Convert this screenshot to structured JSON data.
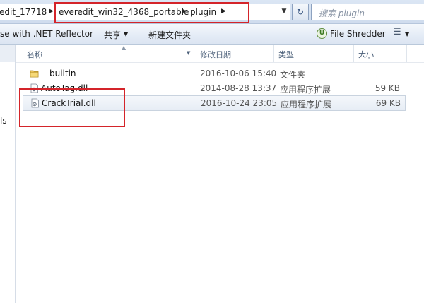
{
  "address_bar": {
    "crumbs": [
      "edit_17718",
      "everedit_win32_4368_portable",
      "plugin"
    ]
  },
  "search": {
    "placeholder": "搜索 plugin"
  },
  "toolbar": {
    "reflector": "se with .NET Reflector",
    "share": "共享",
    "new_folder": "新建文件夹",
    "file_shredder": "File Shredder"
  },
  "columns": {
    "name": "名称",
    "date": "修改日期",
    "type": "类型",
    "size": "大小"
  },
  "nav_pane": {
    "partial_label": "ls"
  },
  "files": [
    {
      "name": "__builtin__",
      "date": "2016-10-06 15:40",
      "type": "文件夹",
      "size": "",
      "icon": "folder-icon"
    },
    {
      "name": "AutoTag.dll",
      "date": "2014-08-28 13:37",
      "type": "应用程序扩展",
      "size": "59 KB",
      "icon": "dll-file-icon"
    },
    {
      "name": "CrackTrial.dll",
      "date": "2016-10-24 23:05",
      "type": "应用程序扩展",
      "size": "69 KB",
      "icon": "dll-file-icon"
    }
  ],
  "colors": {
    "highlight_box": "#d4242a",
    "chrome_blue": "#dbe6f4"
  }
}
